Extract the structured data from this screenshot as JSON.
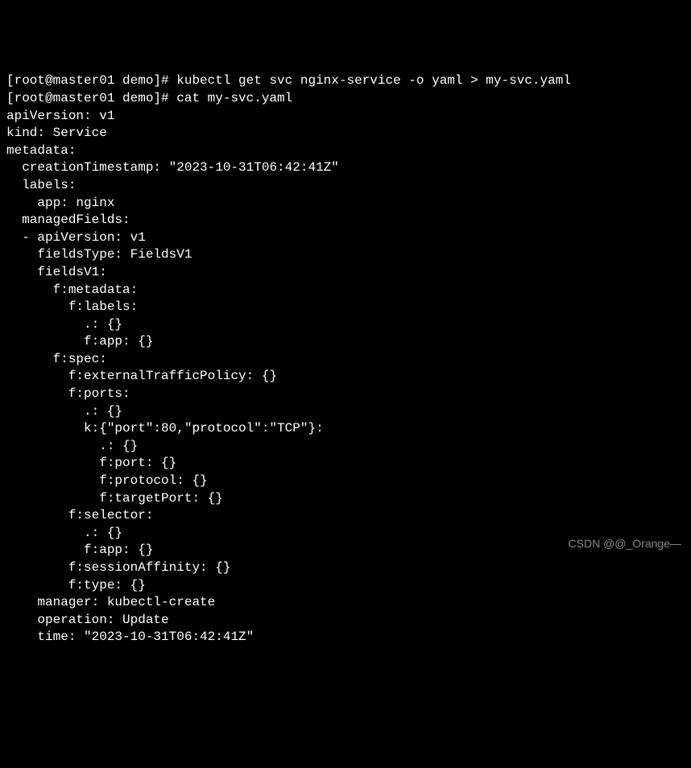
{
  "terminal": {
    "lines": [
      "[root@master01 demo]# kubectl get svc nginx-service -o yaml > my-svc.yaml",
      "[root@master01 demo]# cat my-svc.yaml",
      "apiVersion: v1",
      "kind: Service",
      "metadata:",
      "  creationTimestamp: \"2023-10-31T06:42:41Z\"",
      "  labels:",
      "    app: nginx",
      "  managedFields:",
      "  - apiVersion: v1",
      "    fieldsType: FieldsV1",
      "    fieldsV1:",
      "      f:metadata:",
      "        f:labels:",
      "          .: {}",
      "          f:app: {}",
      "      f:spec:",
      "        f:externalTrafficPolicy: {}",
      "        f:ports:",
      "          .: {}",
      "          k:{\"port\":80,\"protocol\":\"TCP\"}:",
      "            .: {}",
      "            f:port: {}",
      "            f:protocol: {}",
      "            f:targetPort: {}",
      "        f:selector:",
      "          .: {}",
      "          f:app: {}",
      "        f:sessionAffinity: {}",
      "        f:type: {}",
      "    manager: kubectl-create",
      "    operation: Update",
      "    time: \"2023-10-31T06:42:41Z\""
    ]
  },
  "watermark": "CSDN @@_Orange—"
}
